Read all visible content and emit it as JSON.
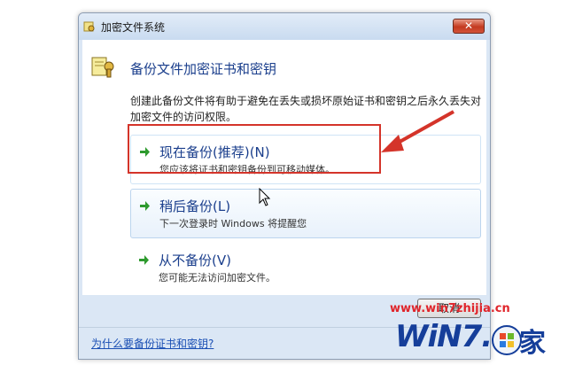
{
  "window": {
    "title": "加密文件系统",
    "close_label": "✕"
  },
  "header": {
    "title": "备份文件加密证书和密钥",
    "description": "创建此备份文件将有助于避免在丢失或损坏原始证书和密钥之后永久丢失对加密文件的访问权限。"
  },
  "options": [
    {
      "title": "现在备份(推荐)(N)",
      "description": "您应该将证书和密钥备份到可移动媒体。"
    },
    {
      "title": "稍后备份(L)",
      "description": "下一次登录时 Windows 将提醒您"
    },
    {
      "title": "从不备份(V)",
      "description": "您可能无法访问加密文件。"
    }
  ],
  "buttons": {
    "cancel_label": "取消"
  },
  "footer": {
    "help_link": "为什么要备份证书和密钥?"
  },
  "watermark": {
    "url": "www.win7zhijia.cn",
    "logo_text": "WiN7.",
    "logo_char": "家"
  },
  "colors": {
    "accent_blue": "#1a3e8c",
    "highlight_red": "#d4342a",
    "arrow_green": "#2e9a2e"
  },
  "icons": {
    "title_icon": "certificate-key-icon",
    "option_icon": "green-arrow-icon"
  }
}
